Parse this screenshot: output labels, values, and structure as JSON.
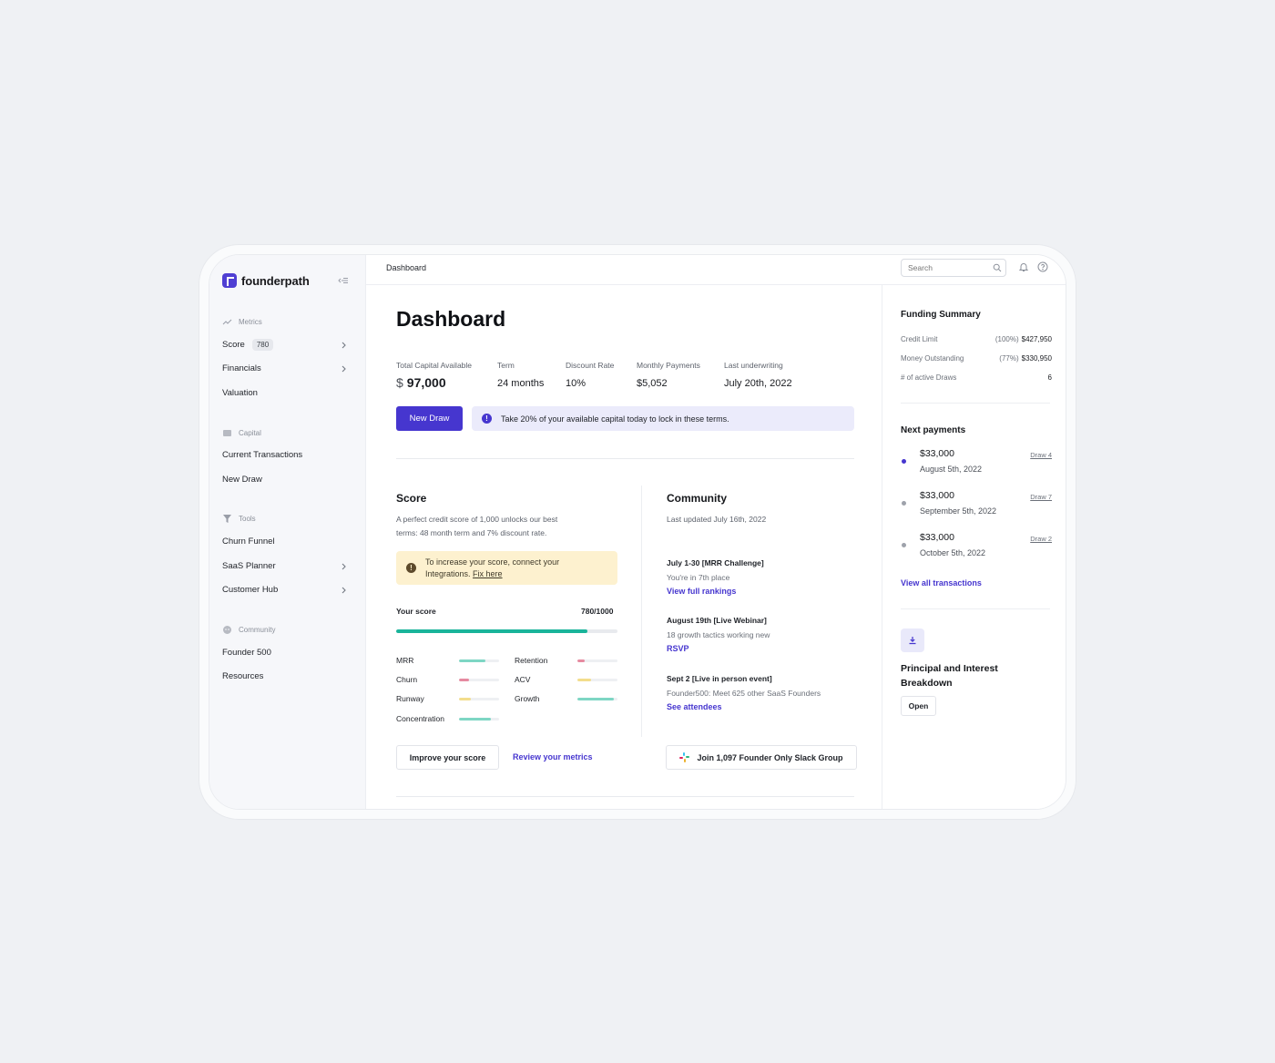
{
  "app": {
    "brand": "founderpath"
  },
  "sidebar": {
    "sections": [
      {
        "heading": "Metrics",
        "icon": "trend-line-icon"
      },
      {
        "heading": "Capital",
        "icon": "wallet-icon"
      },
      {
        "heading": "Tools",
        "icon": "funnel-icon"
      },
      {
        "heading": "Community",
        "icon": "chat-bubbles-icon"
      }
    ],
    "items": {
      "score": {
        "label": "Score",
        "badge": "780"
      },
      "financials": {
        "label": "Financials"
      },
      "valuation": {
        "label": "Valuation"
      },
      "current_transactions": {
        "label": "Current Transactions"
      },
      "new_draw": {
        "label": "New Draw"
      },
      "churn_funnel": {
        "label": "Churn Funnel"
      },
      "saas_planner": {
        "label": "SaaS Planner"
      },
      "customer_hub": {
        "label": "Customer Hub"
      },
      "founder_500": {
        "label": "Founder 500"
      },
      "resources": {
        "label": "Resources"
      }
    }
  },
  "topbar": {
    "breadcrumb": "Dashboard",
    "search_placeholder": "Search"
  },
  "main": {
    "title": "Dashboard",
    "stats": {
      "total_capital": {
        "label": "Total Capital Available",
        "currency": "$",
        "value": "97,000"
      },
      "term": {
        "label": "Term",
        "value": "24 months"
      },
      "discount_rate": {
        "label": "Discount Rate",
        "value": "10%"
      },
      "monthly_payments": {
        "label": "Monthly Payments",
        "value": "$5,052"
      },
      "last_underwriting": {
        "label": "Last underwriting",
        "value": "July 20th, 2022"
      }
    },
    "new_draw_button": "New Draw",
    "info_banner": "Take 20% of your available capital today to lock in these terms.",
    "score": {
      "heading": "Score",
      "description_line1": "A perfect credit score of 1,000 unlocks our best",
      "description_line2": "terms: 48 month term and 7% discount rate.",
      "warning_line1": "To increase your score, connect your",
      "warning_line2": "Integrations.",
      "warning_link": "Fix here",
      "your_score_label": "Your score",
      "your_score_value": "780/1000",
      "progress": 0.78,
      "metrics": [
        {
          "label": "MRR",
          "level": 0.65,
          "color": "#7ed6c4"
        },
        {
          "label": "Retention",
          "level": 0.18,
          "color": "#e68aa0"
        },
        {
          "label": "Churn",
          "level": 0.25,
          "color": "#e68aa0"
        },
        {
          "label": "ACV",
          "level": 0.35,
          "color": "#f3dd8c"
        },
        {
          "label": "Runway",
          "level": 0.3,
          "color": "#f3dd8c"
        },
        {
          "label": "Growth",
          "level": 0.9,
          "color": "#7ed6c4"
        },
        {
          "label": "Concentration",
          "level": 0.8,
          "color": "#7ed6c4"
        }
      ],
      "improve_button": "Improve your score",
      "review_link": "Review your metrics"
    },
    "community": {
      "heading": "Community",
      "updated": "Last updated July 16th, 2022",
      "events": [
        {
          "title": "July 1-30 [MRR Challenge]",
          "sub": "You're in 7th place",
          "link": "View full rankings"
        },
        {
          "title": "August 19th [Live Webinar]",
          "sub": "18 growth tactics working new",
          "link": "RSVP"
        },
        {
          "title": "Sept 2 [Live in person event]",
          "sub": "Founder500: Meet 625 other SaaS Founders",
          "link": "See attendees"
        }
      ],
      "slack_button": "Join 1,097 Founder Only Slack Group"
    }
  },
  "right": {
    "funding_summary": {
      "heading": "Funding Summary",
      "rows": [
        {
          "label": "Credit Limit",
          "pct": "(100%)",
          "value": "$427,950"
        },
        {
          "label": "Money Outstanding",
          "pct": "(77%)",
          "value": "$330,950"
        },
        {
          "label": "# of active Draws",
          "pct": "",
          "value": "6"
        }
      ]
    },
    "next_payments": {
      "heading": "Next payments",
      "items": [
        {
          "amount": "$33,000",
          "date": "August 5th, 2022",
          "draw": "Draw 4",
          "color": "#4636cf"
        },
        {
          "amount": "$33,000",
          "date": "September 5th, 2022",
          "draw": "Draw 7",
          "color": "#9ea2ab"
        },
        {
          "amount": "$33,000",
          "date": "October 5th, 2022",
          "draw": "Draw 2",
          "color": "#9ea2ab"
        }
      ],
      "view_all": "View all transactions"
    },
    "breakdown": {
      "title": "Principal and Interest Breakdown",
      "open_button": "Open"
    }
  }
}
